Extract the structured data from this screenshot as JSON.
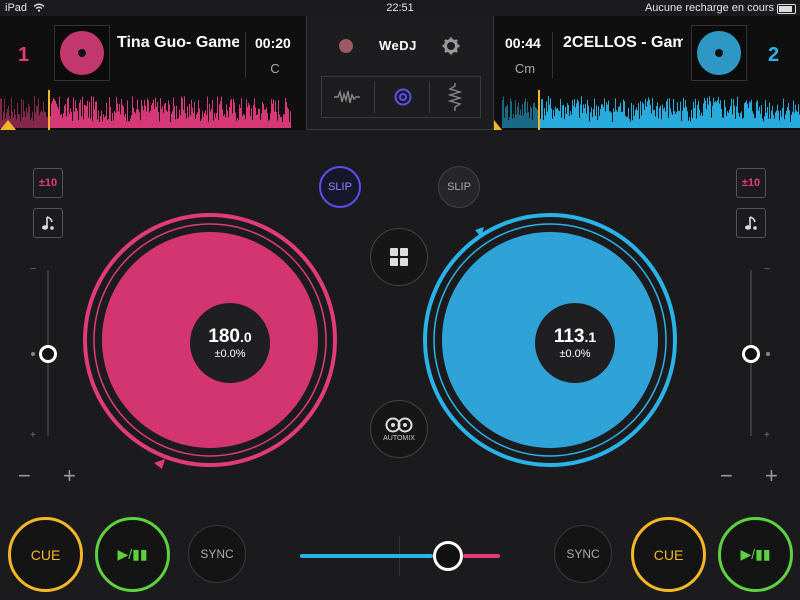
{
  "status_bar": {
    "device": "iPad",
    "time": "22:51",
    "battery_text": "Aucune recharge en cours"
  },
  "deck_left": {
    "number": "1",
    "title": "Tina Guo- Game",
    "time": "00:20",
    "key": "C",
    "bpm_main": "180",
    "bpm_dec": ".0",
    "pitch": "±0.0%",
    "range": "±10",
    "slip_label": "SLIP",
    "cue_label": "CUE",
    "play_label": "▶/▮▮",
    "sync_label": "SYNC",
    "color": "#e23a7c",
    "platter": "#d2356f"
  },
  "deck_right": {
    "number": "2",
    "title": "2CELLOS - Gam",
    "time": "00:44",
    "key": "Cm",
    "bpm_main": "113",
    "bpm_dec": ".1",
    "pitch": "±0.0%",
    "range": "±10",
    "slip_label": "SLIP",
    "cue_label": "CUE",
    "play_label": "▶/▮▮",
    "sync_label": "SYNC",
    "color": "#28b4e8",
    "platter": "#2fa3d8"
  },
  "center": {
    "brand": "WeDJ",
    "automix_label": "AUTOMIX"
  },
  "crossfader": {
    "position": 0.74
  },
  "colors": {
    "accent_pink": "#e23a7c",
    "accent_blue": "#28b4e8",
    "cue": "#f5b628",
    "play": "#5fd13e",
    "slip_active": "#5a4ff0"
  },
  "icons": [
    "wifi-icon",
    "record-icon",
    "gear-icon",
    "waveform-icon",
    "target-icon",
    "eq-icon",
    "grid-icon",
    "automix-icon",
    "note-icon",
    "minus-icon",
    "plus-icon"
  ]
}
